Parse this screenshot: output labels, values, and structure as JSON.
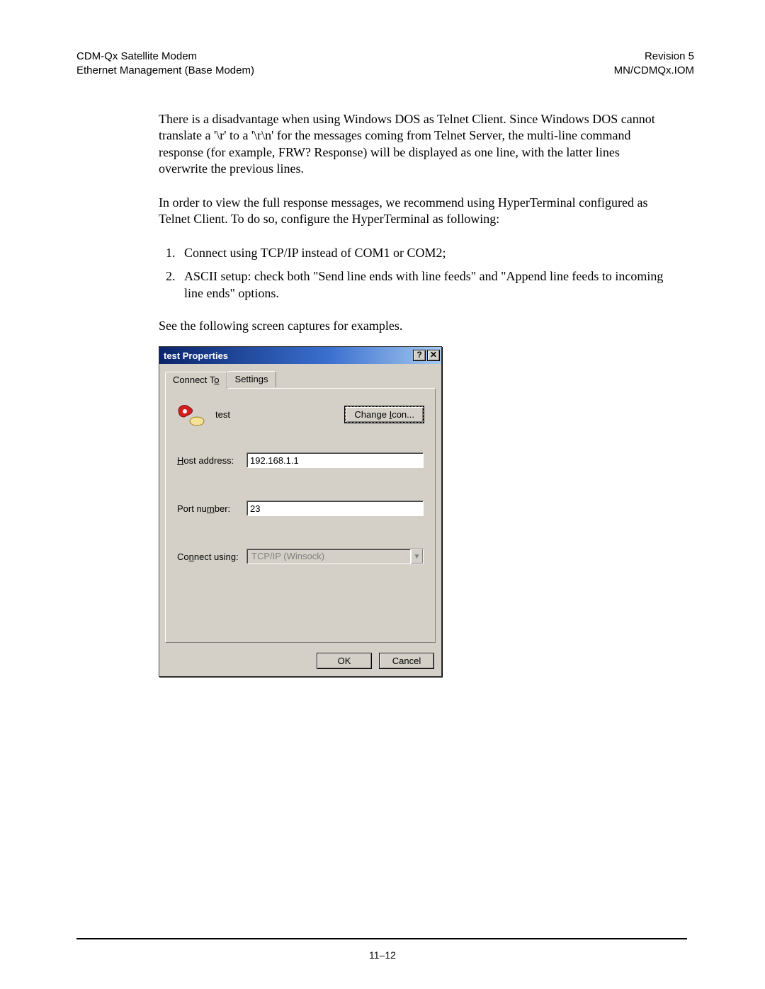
{
  "header": {
    "left_line1": "CDM-Qx Satellite Modem",
    "left_line2": "Ethernet Management (Base Modem)",
    "right_line1": "Revision 5",
    "right_line2": "MN/CDMQx.IOM"
  },
  "body": {
    "para1": "There is a disadvantage when using Windows DOS as Telnet Client. Since Windows DOS cannot translate a '\\r' to a '\\r\\n' for the messages coming from Telnet Server, the multi-line command response (for example, FRW? Response) will be displayed as one line, with the latter lines overwrite the previous lines.",
    "para2": "In order to view the full response messages, we recommend using HyperTerminal configured as Telnet Client. To do so, configure the HyperTerminal as following:",
    "step1": "Connect using TCP/IP instead of COM1 or COM2;",
    "step2": "ASCII setup: check both \"Send line ends with line feeds\" and \"Append line feeds to incoming line ends\" options.",
    "caption": "See the following screen captures for examples."
  },
  "dialog": {
    "title": "test Properties",
    "help_btn": "?",
    "close_btn": "✕",
    "tabs": {
      "connect_to_pre": "Connect T",
      "connect_to_ul": "o",
      "settings": "Settings"
    },
    "connection_name": "test",
    "change_icon_pre": "Change ",
    "change_icon_ul": "I",
    "change_icon_post": "con...",
    "labels": {
      "host_ul": "H",
      "host_post": "ost address:",
      "port_pre": "Port nu",
      "port_ul": "m",
      "port_post": "ber:",
      "connect_pre": "Co",
      "connect_ul": "n",
      "connect_post": "nect using:"
    },
    "host_address": "192.168.1.1",
    "port_number": "23",
    "connect_using": "TCP/IP (Winsock)",
    "ok": "OK",
    "cancel": "Cancel"
  },
  "footer": {
    "page_number": "11–12"
  }
}
